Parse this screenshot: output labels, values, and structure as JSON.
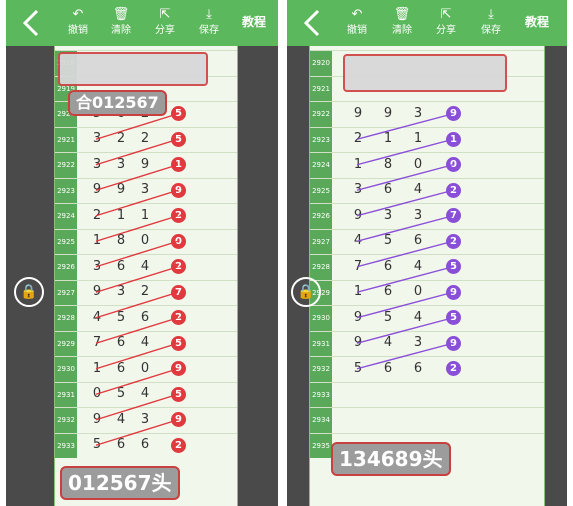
{
  "toolbar": {
    "undo": "撤销",
    "clear": "清除",
    "share": "分享",
    "save": "保存",
    "tutorial": "教程"
  },
  "left": {
    "top_label": "合012567",
    "bottom_label": "012567头",
    "issues": [
      "2918",
      "2919",
      "2920",
      "2921",
      "2922",
      "2923",
      "2924",
      "2925",
      "2926",
      "2927",
      "2928",
      "2929",
      "2930",
      "2931",
      "2932",
      "2933"
    ],
    "rows": [
      [
        "5",
        "6",
        "2",
        "5"
      ],
      [
        "3",
        "2",
        "2",
        "5"
      ],
      [
        "3",
        "3",
        "9",
        "1"
      ],
      [
        "9",
        "9",
        "3",
        "9"
      ],
      [
        "2",
        "1",
        "1",
        "2"
      ],
      [
        "1",
        "8",
        "0",
        "0"
      ],
      [
        "3",
        "6",
        "4",
        "2"
      ],
      [
        "9",
        "3",
        "2",
        "7"
      ],
      [
        "4",
        "5",
        "6",
        "2"
      ],
      [
        "7",
        "6",
        "4",
        "5"
      ],
      [
        "1",
        "6",
        "0",
        "9"
      ],
      [
        "0",
        "5",
        "4",
        "5"
      ],
      [
        "9",
        "4",
        "3",
        "9"
      ],
      [
        "5",
        "6",
        "6",
        "2"
      ]
    ]
  },
  "right": {
    "bottom_label": "134689头",
    "issues": [
      "2920",
      "2921",
      "2922",
      "2923",
      "2924",
      "2925",
      "2926",
      "2927",
      "2928",
      "2929",
      "2930",
      "2931",
      "2932",
      "2933",
      "2934",
      "2935"
    ],
    "rows": [
      [
        "9",
        "9",
        "3",
        "9"
      ],
      [
        "2",
        "1",
        "1",
        "1"
      ],
      [
        "1",
        "8",
        "0",
        "0"
      ],
      [
        "3",
        "6",
        "4",
        "2"
      ],
      [
        "9",
        "3",
        "3",
        "7"
      ],
      [
        "4",
        "5",
        "6",
        "2"
      ],
      [
        "7",
        "6",
        "4",
        "5"
      ],
      [
        "1",
        "6",
        "0",
        "9"
      ],
      [
        "9",
        "5",
        "4",
        "5"
      ],
      [
        "9",
        "4",
        "3",
        "9"
      ],
      [
        "5",
        "6",
        "6",
        "2"
      ]
    ]
  }
}
